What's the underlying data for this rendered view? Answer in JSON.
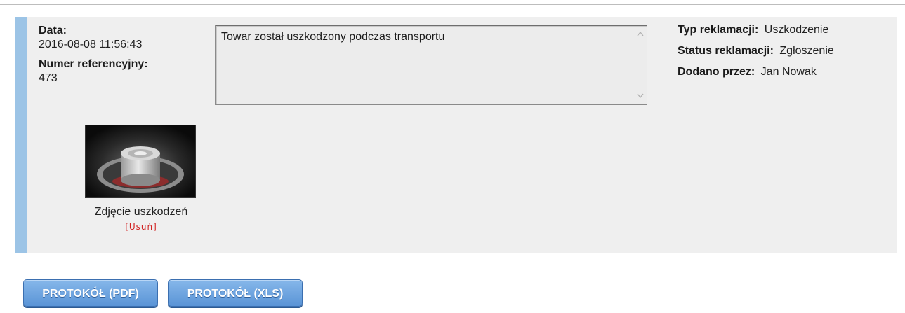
{
  "details": {
    "date_label": "Data:",
    "date_value": "2016-08-08 11:56:43",
    "ref_label": "Numer referencyjny:",
    "ref_value": "473"
  },
  "description": {
    "text": "Towar został uszkodzony podczas transportu"
  },
  "info": {
    "type_label": "Typ reklamacji:",
    "type_value": "Uszkodzenie",
    "status_label": "Status reklamacji:",
    "status_value": "Zgłoszenie",
    "added_by_label": "Dodano przez:",
    "added_by_value": "Jan Nowak"
  },
  "attachment": {
    "caption": "Zdjęcie uszkodzeń",
    "delete_label": "[Usuń]",
    "icon": "photo-thumbnail"
  },
  "actions": {
    "pdf_label": "PROTOKÓŁ (PDF)",
    "xls_label": "PROTOKÓŁ (XLS)"
  },
  "colors": {
    "accent_bar": "#9cc4e6",
    "panel_bg": "#efefef",
    "button_bg": "#5a94d6",
    "delete_link": "#d12020"
  }
}
